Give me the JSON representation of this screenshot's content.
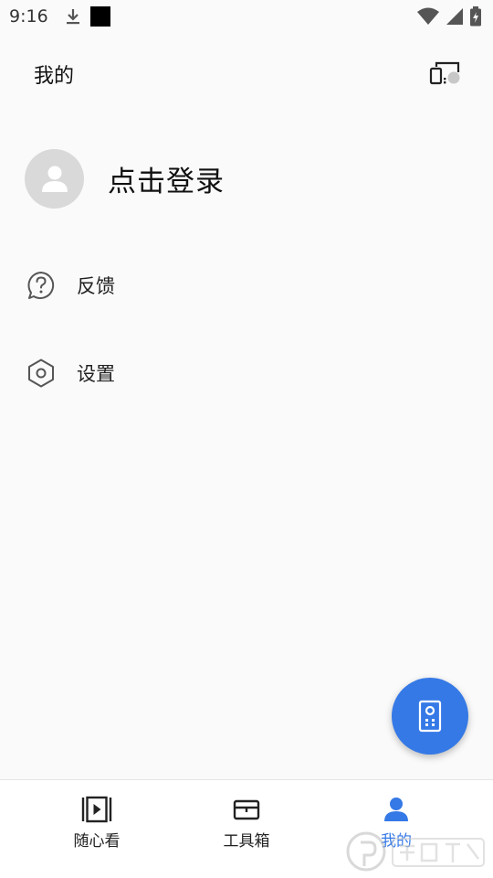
{
  "status_bar": {
    "time": "9:16",
    "icons": [
      "download-icon",
      "square-notification-icon",
      "wifi-icon",
      "signal-icon",
      "battery-charging-icon"
    ]
  },
  "header": {
    "title": "我的",
    "cast_icon": "screen-cast-icon"
  },
  "profile": {
    "login_label": "点击登录",
    "avatar_icon": "user-avatar-icon"
  },
  "menu": {
    "items": [
      {
        "label": "反馈",
        "icon": "help-circle-icon"
      },
      {
        "label": "设置",
        "icon": "hexagon-settings-icon"
      }
    ]
  },
  "fab": {
    "icon": "remote-control-icon"
  },
  "bottom_nav": {
    "items": [
      {
        "label": "随心看",
        "icon": "video-play-icon",
        "active": false
      },
      {
        "label": "工具箱",
        "icon": "toolbox-icon",
        "active": false
      },
      {
        "label": "我的",
        "icon": "person-icon",
        "active": true
      }
    ]
  },
  "colors": {
    "accent": "#3579e6",
    "background": "#fafafa",
    "avatar_bg": "#d9d9d9"
  }
}
